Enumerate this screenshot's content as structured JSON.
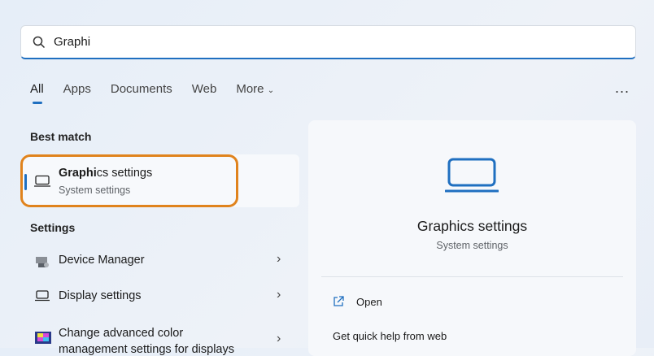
{
  "search": {
    "value": "Graphi"
  },
  "tabs": [
    "All",
    "Apps",
    "Documents",
    "Web",
    "More"
  ],
  "more_options": "...",
  "best_match": {
    "heading": "Best match",
    "title_bold": "Graphi",
    "title_rest": "cs settings",
    "subtitle": "System settings"
  },
  "settings": {
    "heading": "Settings",
    "items": [
      {
        "label": "Device Manager"
      },
      {
        "label": "Display settings"
      },
      {
        "label": "Change advanced color",
        "label2": "management settings for displays"
      }
    ]
  },
  "preview": {
    "title": "Graphics settings",
    "subtitle": "System settings",
    "actions": [
      "Open",
      "Get quick help from web"
    ]
  },
  "colors": {
    "accent": "#1f6fc0",
    "highlight": "#e0831d"
  }
}
